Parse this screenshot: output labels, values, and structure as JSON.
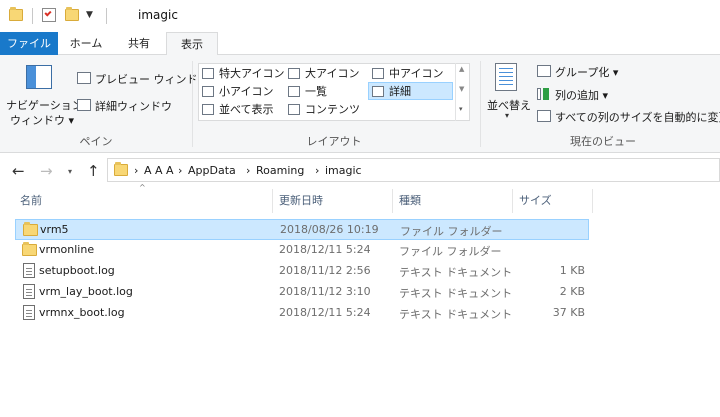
{
  "window": {
    "title": "imagic"
  },
  "tabs": [
    {
      "label": "ファイル"
    },
    {
      "label": "ホーム"
    },
    {
      "label": "共有"
    },
    {
      "label": "表示"
    }
  ],
  "ribbon": {
    "panes": {
      "nav_pane": "ナビゲーション",
      "nav_pane_sub": "ウィンドウ",
      "preview": "プレビュー ウィンドウ",
      "details": "詳細ウィンドウ",
      "label": "ペイン"
    },
    "layout": {
      "items": [
        "特大アイコン",
        "大アイコン",
        "中アイコン",
        "小アイコン",
        "一覧",
        "詳細",
        "並べて表示",
        "コンテンツ"
      ],
      "selected": "詳細",
      "label": "レイアウト"
    },
    "current_view": {
      "sort_by": "並べ替え",
      "group_by": "グループ化",
      "add_column": "列の追加",
      "autosize": "すべての列のサイズを自動的に変更",
      "label": "現在のビュー"
    }
  },
  "address": {
    "separator": "›",
    "crumbs": [
      "A A A",
      "AppData",
      "Roaming",
      "imagic"
    ]
  },
  "columns": {
    "name": "名前",
    "date": "更新日時",
    "type": "種類",
    "size": "サイズ"
  },
  "files": [
    {
      "name": "vrm5",
      "date": "2018/08/26 10:19",
      "type": "ファイル フォルダー",
      "size": "",
      "kind": "folder",
      "selected": true
    },
    {
      "name": "vrmonline",
      "date": "2018/12/11 5:24",
      "type": "ファイル フォルダー",
      "size": "",
      "kind": "folder",
      "selected": false
    },
    {
      "name": "setupboot.log",
      "date": "2018/11/12 2:56",
      "type": "テキスト ドキュメント",
      "size": "1 KB",
      "kind": "text",
      "selected": false
    },
    {
      "name": "vrm_lay_boot.log",
      "date": "2018/11/12 3:10",
      "type": "テキスト ドキュメント",
      "size": "2 KB",
      "kind": "text",
      "selected": false
    },
    {
      "name": "vrmnx_boot.log",
      "date": "2018/12/11 5:24",
      "type": "テキスト ドキュメント",
      "size": "37 KB",
      "kind": "text",
      "selected": false
    }
  ],
  "colors": {
    "accent": "#1979ca",
    "selection": "#cce8ff",
    "selection_border": "#99d1ff",
    "folder": "#f8d775"
  }
}
